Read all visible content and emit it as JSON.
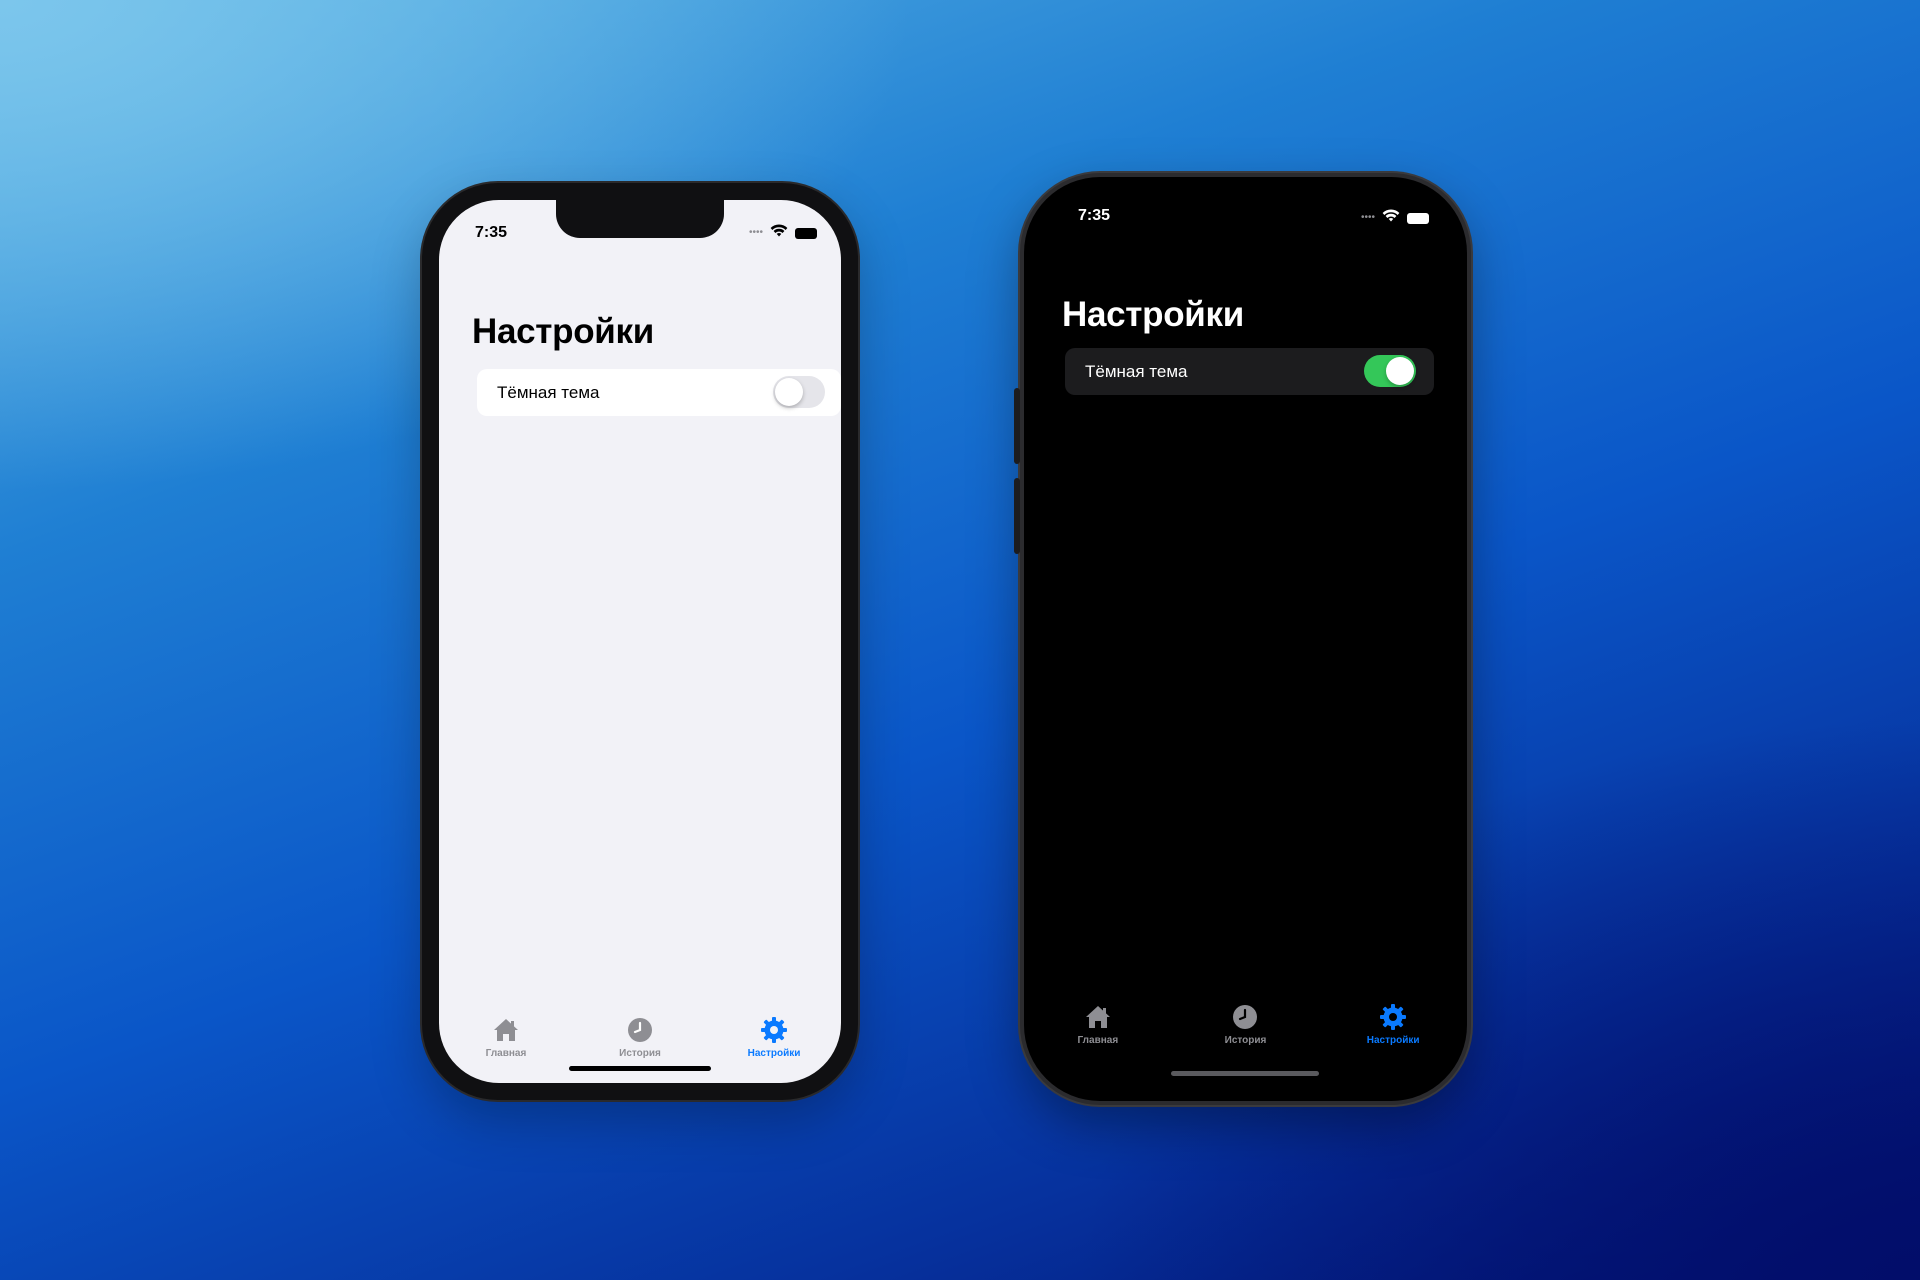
{
  "colors": {
    "accent": "#0a7aff",
    "toggle_on": "#34c759",
    "toggle_off": "#e5e5ea",
    "tab_inactive": "#8e8e93",
    "light_bg": "#f2f2f7",
    "dark_bg": "#000000",
    "dark_row": "#1c1c1e"
  },
  "light": {
    "status_time": "7:35",
    "title": "Настройки",
    "setting_label": "Тёмная тема",
    "dark_theme_enabled": false,
    "tabs": [
      {
        "label": "Главная",
        "icon": "house-icon",
        "active": false
      },
      {
        "label": "История",
        "icon": "clock-icon",
        "active": false
      },
      {
        "label": "Настройки",
        "icon": "gear-icon",
        "active": true
      }
    ]
  },
  "dark": {
    "status_time": "7:35",
    "title": "Настройки",
    "setting_label": "Тёмная тема",
    "dark_theme_enabled": true,
    "tabs": [
      {
        "label": "Главная",
        "icon": "house-icon",
        "active": false
      },
      {
        "label": "История",
        "icon": "clock-icon",
        "active": false
      },
      {
        "label": "Настройки",
        "icon": "gear-icon",
        "active": true
      }
    ]
  }
}
